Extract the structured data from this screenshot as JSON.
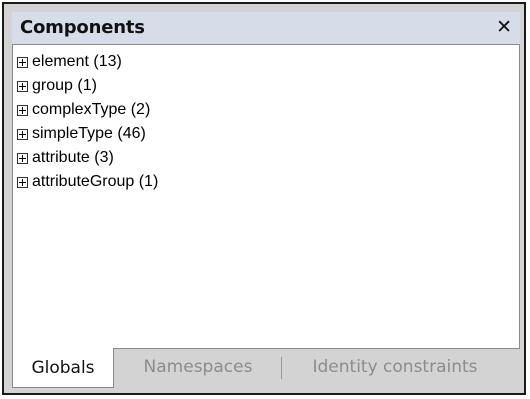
{
  "panel": {
    "title": "Components",
    "close_glyph": "✕"
  },
  "tree": {
    "items": [
      {
        "label": "element (13)",
        "icon": "plus-box-icon"
      },
      {
        "label": "group (1)",
        "icon": "plus-box-icon"
      },
      {
        "label": "complexType (2)",
        "icon": "plus-box-icon"
      },
      {
        "label": "simpleType (46)",
        "icon": "plus-box-icon"
      },
      {
        "label": "attribute (3)",
        "icon": "plus-box-icon"
      },
      {
        "label": "attributeGroup (1)",
        "icon": "plus-box-icon"
      }
    ]
  },
  "tabs": [
    {
      "label": "Globals",
      "active": true
    },
    {
      "label": "Namespaces",
      "active": false
    },
    {
      "label": "Identity constraints",
      "active": false
    }
  ],
  "colors": {
    "titlebar": "#d6dde8",
    "frame": "#d3d3d3",
    "inactive_tab_text": "#8c8c8c"
  }
}
